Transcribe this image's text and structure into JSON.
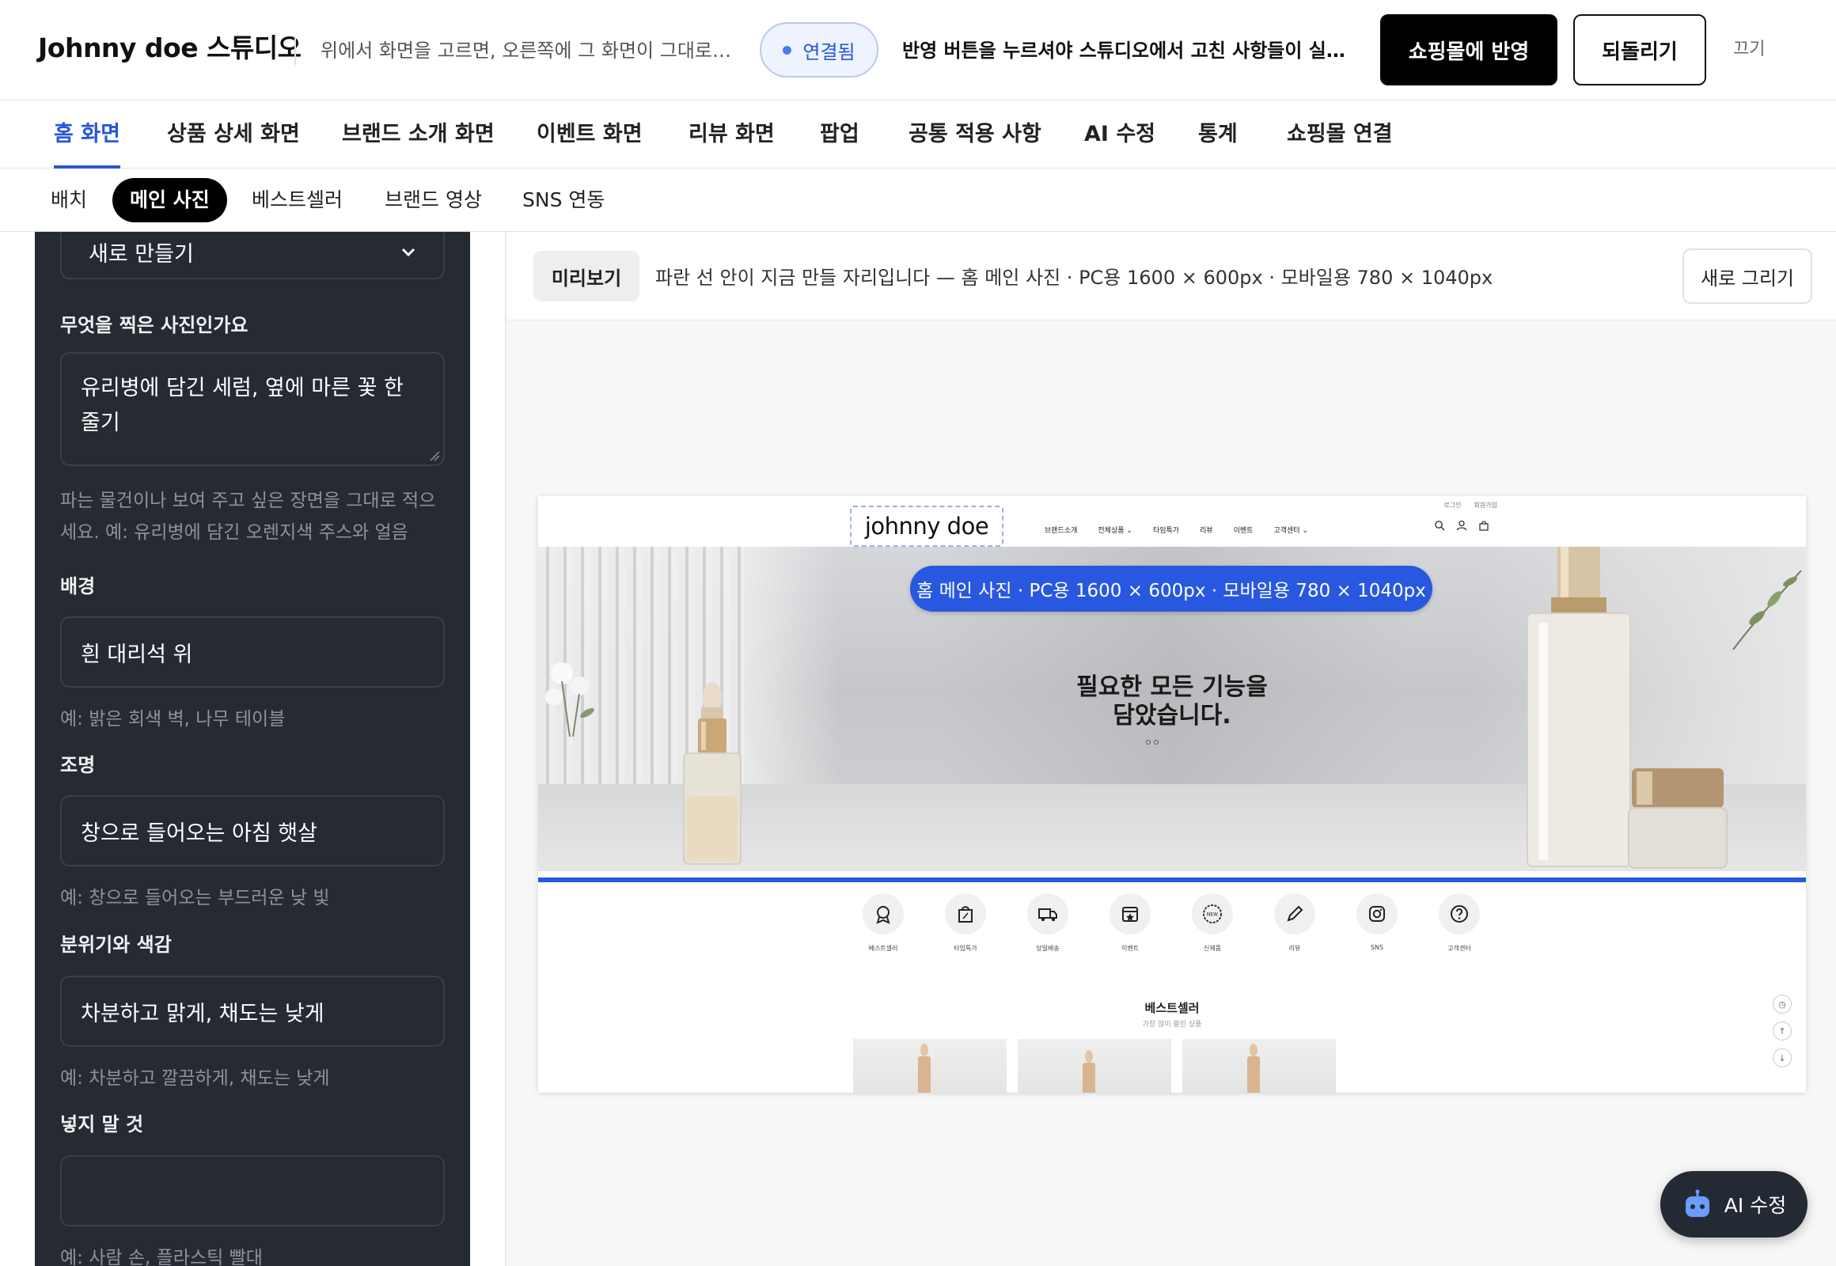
{
  "header": {
    "title": "Johnny doe 스튜디오",
    "description": "위에서 화면을 고르면, 오른쪽에 그 화면이 그대로 보입니다",
    "status": "연결됨",
    "note": "반영 버튼을 누르셔야 스튜디오에서 고친 사항들이 실제로 쇼핑몰에 반영됩니다",
    "apply_label": "쇼핑몰에 반영",
    "revert_label": "되돌리기",
    "off_label": "끄기"
  },
  "main_tabs": [
    {
      "label": "홈 화면",
      "active": true
    },
    {
      "label": "상품 상세 화면"
    },
    {
      "label": "브랜드 소개 화면"
    },
    {
      "label": "이벤트 화면"
    },
    {
      "label": "리뷰 화면"
    },
    {
      "label": "팝업"
    },
    {
      "label": "공통 적용 사항"
    },
    {
      "label": "AI 수정"
    },
    {
      "label": "통계"
    },
    {
      "label": "쇼핑몰 연결"
    }
  ],
  "sub_tabs": [
    {
      "label": "배치"
    },
    {
      "label": "메인 사진",
      "active": true
    },
    {
      "label": "베스트셀러"
    },
    {
      "label": "브랜드 영상"
    },
    {
      "label": "SNS 연동"
    }
  ],
  "form": {
    "mode_select": "새로 만들기",
    "subject_label": "무엇을 찍은 사진인가요",
    "subject_value": "유리병에 담긴 세럼, 옆에 마른 꽃 한 줄기",
    "subject_help": "파는 물건이나 보여 주고 싶은 장면을 그대로 적으세요. 예: 유리병에 담긴 오렌지색 주스와 얼음",
    "background_label": "배경",
    "background_value": "흰 대리석 위",
    "background_help": "예: 밝은 회색 벽, 나무 테이블",
    "lighting_label": "조명",
    "lighting_value": "창으로 들어오는 아침 햇살",
    "lighting_help": "예: 창으로 들어오는 부드러운 낮 빛",
    "mood_label": "분위기와 색감",
    "mood_value": "차분하고 맑게, 채도는 낮게",
    "mood_help": "예: 차분하고 깔끔하게, 채도는 낮게",
    "exclude_label": "넣지 말 것",
    "exclude_value": "",
    "exclude_help": "예: 사람 손, 플라스틱 빨대"
  },
  "preview": {
    "chip": "미리보기",
    "description": "파란 선 안이 지금 만들 자리입니다 — 홈 메인 사진 · PC용 1600 × 600px · 모바일용 780 × 1040px",
    "redraw_label": "새로 그리기"
  },
  "site": {
    "top_links": [
      "로그인",
      "회원가입"
    ],
    "logo": "johnny  doe",
    "nav": [
      "브랜드소개",
      "전체상품 ⌄",
      "타임특가",
      "리뷰",
      "이벤트",
      "고객센터 ⌄"
    ],
    "hero_badge": "홈 메인 사진 · PC용 1600 × 600px · 모바일용 780 × 1040px",
    "hero_title_1": "필요한 모든 기능을",
    "hero_title_2": "담았습니다.",
    "quick_menu": [
      "베스트셀러",
      "타임특가",
      "당일배송",
      "이벤트",
      "신제품",
      "리뷰",
      "SNS",
      "고객센터"
    ],
    "best_title": "베스트셀러",
    "best_sub": "가장 많이 팔린 상품"
  },
  "ai_button": "AI 수정",
  "colors": {
    "accent": "#2956d8",
    "panel": "#252a33",
    "black": "#000000"
  }
}
